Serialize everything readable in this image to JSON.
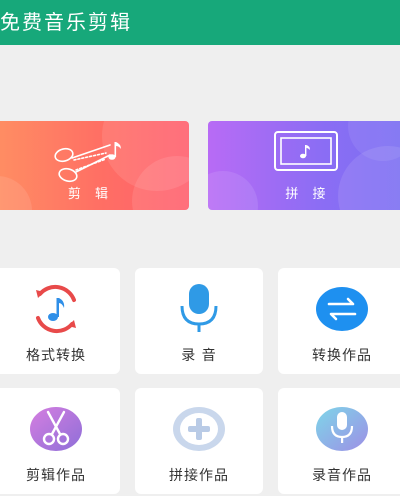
{
  "header": {
    "title": "免费音乐剪辑",
    "bg": "#17a87a"
  },
  "cards": [
    {
      "label": "剪 辑",
      "icon": "scissors-music-icon"
    },
    {
      "label": "拼 接",
      "icon": "screen-music-icon"
    }
  ],
  "tiles": [
    {
      "label": "格式转换",
      "icon": "music-convert-icon"
    },
    {
      "label": "录 音",
      "icon": "microphone-icon"
    },
    {
      "label": "转换作品",
      "icon": "swap-arrows-icon"
    },
    {
      "label": "剪辑作品",
      "icon": "scissors-icon"
    },
    {
      "label": "拼接作品",
      "icon": "plus-circle-icon"
    },
    {
      "label": "录音作品",
      "icon": "mic-circle-icon"
    }
  ]
}
